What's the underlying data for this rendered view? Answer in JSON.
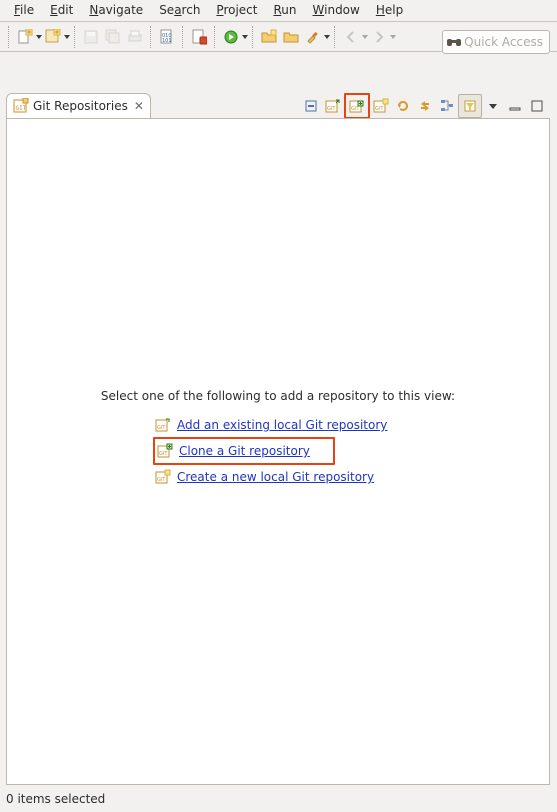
{
  "menu": {
    "file": "File",
    "edit": "Edit",
    "navigate": "Navigate",
    "search": "Search",
    "project": "Project",
    "run": "Run",
    "window": "Window",
    "help": "Help"
  },
  "quick_access": "Quick Access",
  "view": {
    "tab_title": "Git Repositories",
    "prompt": "Select one of the following to add a repository to this view:",
    "link_add": "Add an existing local Git repository",
    "link_clone": "Clone a Git repository",
    "link_create": "Create a new local Git repository"
  },
  "status": "0 items selected"
}
